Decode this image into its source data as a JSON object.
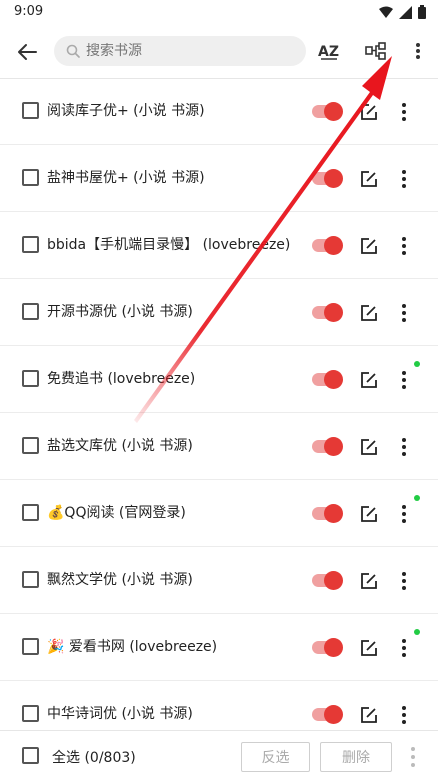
{
  "status_bar": {
    "time": "9:09"
  },
  "toolbar": {
    "search_placeholder": "搜索书源"
  },
  "sources": [
    {
      "label": "阅读库子优+ (小说 书源)",
      "enabled": true,
      "new_dot": false
    },
    {
      "label": "盐神书屋优+ (小说 书源)",
      "enabled": true,
      "new_dot": false
    },
    {
      "label": "bbida【手机端目录慢】 (lovebreeze)",
      "enabled": true,
      "new_dot": false
    },
    {
      "label": "开源书源优 (小说 书源)",
      "enabled": true,
      "new_dot": false
    },
    {
      "label": "免费追书 (lovebreeze)",
      "enabled": true,
      "new_dot": true
    },
    {
      "label": "盐选文库优 (小说 书源)",
      "enabled": true,
      "new_dot": false
    },
    {
      "label": "💰QQ阅读 (官网登录)",
      "enabled": true,
      "new_dot": true
    },
    {
      "label": "飘然文学优 (小说 书源)",
      "enabled": true,
      "new_dot": false
    },
    {
      "label": "🎉 爱看书网 (lovebreeze)",
      "enabled": true,
      "new_dot": true
    },
    {
      "label": "中华诗词优 (小说 书源)",
      "enabled": true,
      "new_dot": false
    }
  ],
  "bottom_bar": {
    "select_all_label": "全选 (0/803)",
    "invert_label": "反选",
    "delete_label": "删除"
  },
  "colors": {
    "accent": "#e53935",
    "toggle_track": "#f0a0a0",
    "new_dot": "#22cc44",
    "annotation_arrow": "#e8141c"
  }
}
